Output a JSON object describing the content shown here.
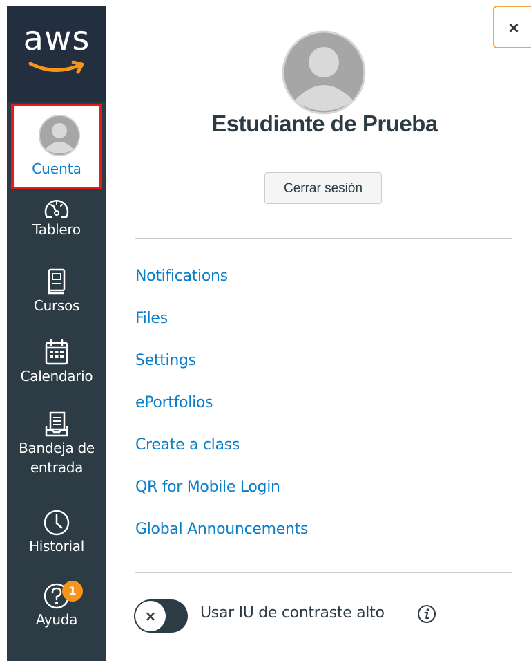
{
  "brand": {
    "logo_text": "aws",
    "brand_color": "#f7941d"
  },
  "nav": {
    "account": {
      "label": "Cuenta",
      "icon": "user-avatar-icon"
    },
    "items": [
      {
        "label": "Tablero",
        "icon": "dashboard-gauge-icon"
      },
      {
        "label": "Cursos",
        "icon": "book-icon"
      },
      {
        "label": "Calendario",
        "icon": "calendar-icon"
      },
      {
        "label": "Bandeja de entrada",
        "icon": "inbox-icon"
      },
      {
        "label": "Historial",
        "icon": "clock-icon"
      },
      {
        "label": "Ayuda",
        "icon": "help-icon",
        "badge": "1"
      }
    ]
  },
  "tray": {
    "close_label": "×",
    "user_name": "Estudiante de Prueba",
    "logout_label": "Cerrar sesión",
    "links": [
      "Notifications",
      "Files",
      "Settings",
      "ePortfolios",
      "Create a class",
      "QR for Mobile Login",
      "Global Announcements"
    ],
    "toggle_knob": "×",
    "contrast_label": "Usar IU de contraste alto",
    "info_icon": "info-icon"
  },
  "colors": {
    "sidebar": "#2d3b45",
    "logo_bg": "#232f3e",
    "link": "#0b7ec8",
    "highlight_border": "#e21b1b",
    "close_border": "#f3a83a"
  }
}
